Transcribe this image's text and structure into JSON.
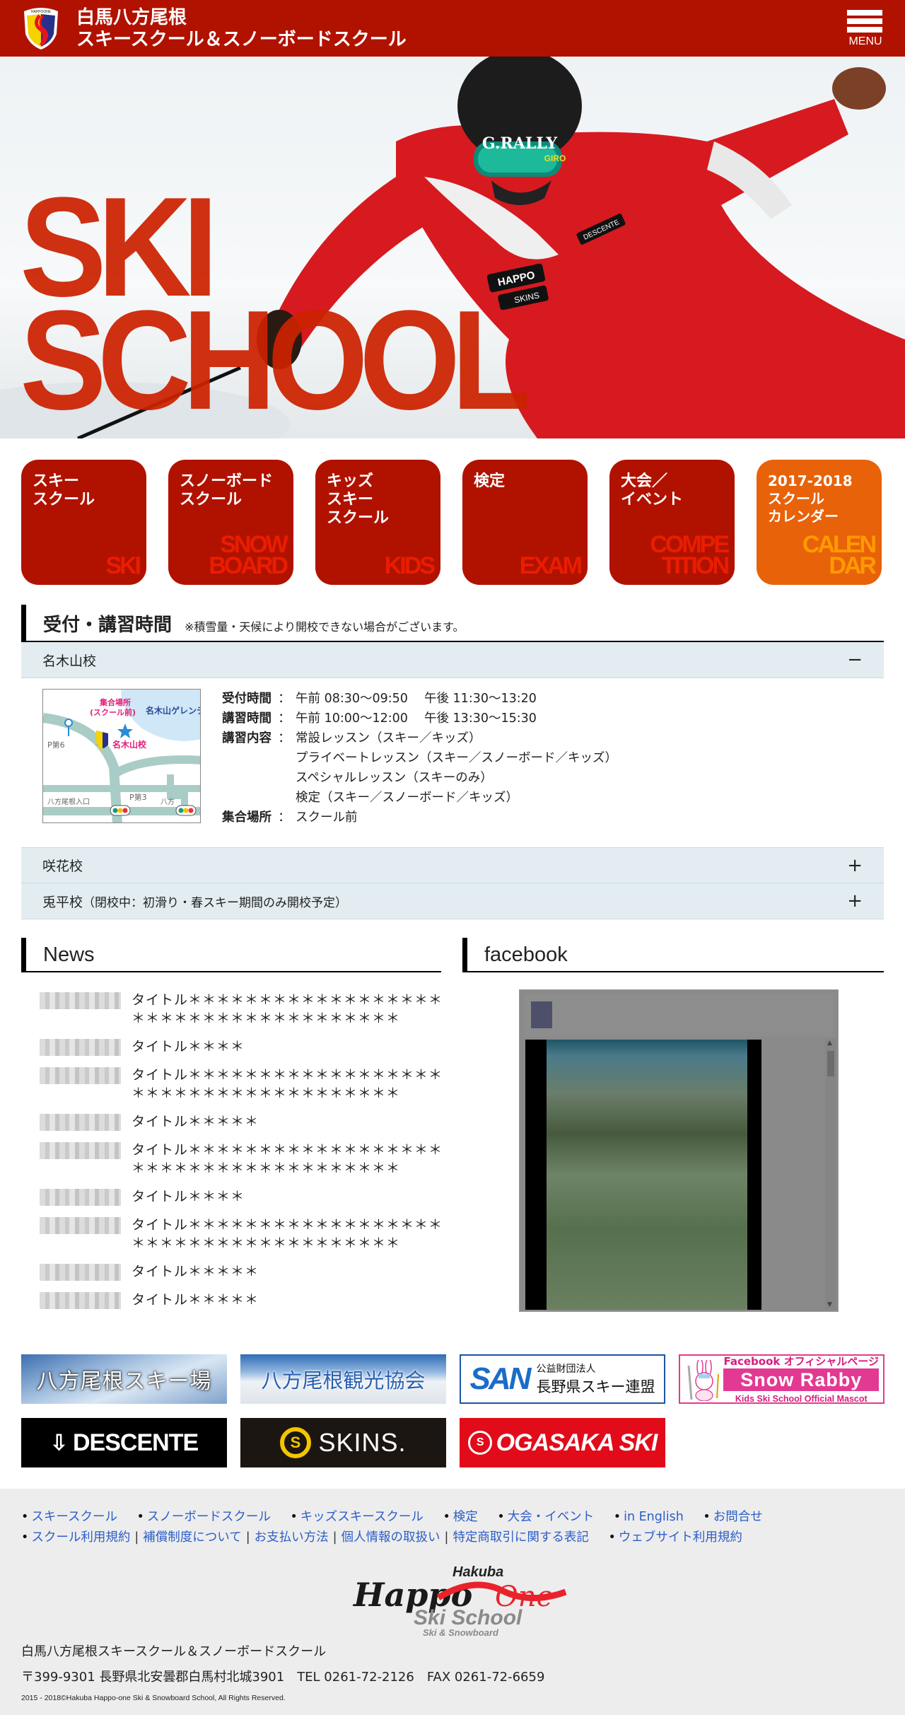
{
  "header": {
    "title_line1": "白馬八方尾根",
    "title_line2": "スキースクール＆スノーボードスクール",
    "logo_text": "HAPPOONE",
    "menu_label": "MENU"
  },
  "hero": {
    "line1": "SKI",
    "line2": "SCHOOL",
    "helmet_text": "G.RALLY",
    "helmet_brand": "GIRO",
    "badge_happo": "HAPPO",
    "badge_skins": "SKINS",
    "badge_descente": "DESCENTE"
  },
  "tiles": [
    {
      "jp": "スキー\nスクール",
      "en": "SKI",
      "color": "#b11200"
    },
    {
      "jp": "スノーボード\nスクール",
      "en": "SNOW\nBOARD",
      "color": "#b11200"
    },
    {
      "jp": "キッズ\nスキー\nスクール",
      "en": "KIDS",
      "color": "#b11200"
    },
    {
      "jp": "検定",
      "en": "EXAM",
      "color": "#b11200"
    },
    {
      "jp": "大会／\nイベント",
      "en": "COMPE\nTITION",
      "color": "#b11200"
    },
    {
      "jp": "2017-2018\nスクール\nカレンダー",
      "en": "CALEN\nDAR",
      "color": "#e8620a"
    }
  ],
  "hours": {
    "title": "受付・講習時間",
    "note": "※積雪量・天候により開校できない場合がございます。",
    "schools": [
      {
        "name": "名木山校",
        "sub": "",
        "expanded": true,
        "toggle": "−"
      },
      {
        "name": "咲花校",
        "sub": "",
        "expanded": false,
        "toggle": "+"
      },
      {
        "name": "兎平校",
        "sub": "（閉校中：初滑り・春スキー期間のみ開校予定）",
        "expanded": false,
        "toggle": "+"
      }
    ],
    "map": {
      "meeting_point": "集合場所\n（スクール前）",
      "slope": "名木山ゲレンデ",
      "school": "名木山校",
      "p6": "P第6",
      "p3": "P第3",
      "entrance": "八方尾根入口",
      "happo": "八方"
    },
    "details": [
      {
        "key": "受付時間",
        "colon": "：",
        "value": "午前 08:30〜09:50　 午後 11:30〜13:20"
      },
      {
        "key": "講習時間",
        "colon": "：",
        "value": "午前 10:00〜12:00　 午後 13:30〜15:30"
      },
      {
        "key": "講習内容",
        "colon": "：",
        "value": "常設レッスン（スキー／キッズ）"
      },
      {
        "key": "",
        "colon": "",
        "value": "プライベートレッスン（スキー／スノーボード／キッズ）"
      },
      {
        "key": "",
        "colon": "",
        "value": "スペシャルレッスン（スキーのみ）"
      },
      {
        "key": "",
        "colon": "",
        "value": "検定（スキー／スノーボード／キッズ）"
      },
      {
        "key": "集合場所",
        "colon": "：",
        "value": "スクール前"
      }
    ]
  },
  "news": {
    "title": "News",
    "items": [
      {
        "title": "タイトル＊＊＊＊＊＊＊＊＊＊＊＊＊＊＊＊＊＊＊＊＊＊＊＊＊＊＊＊＊＊＊＊＊＊＊＊＊"
      },
      {
        "title": "タイトル＊＊＊＊"
      },
      {
        "title": "タイトル＊＊＊＊＊＊＊＊＊＊＊＊＊＊＊＊＊＊＊＊＊＊＊＊＊＊＊＊＊＊＊＊＊＊＊＊＊"
      },
      {
        "title": "タイトル＊＊＊＊＊"
      },
      {
        "title": "タイトル＊＊＊＊＊＊＊＊＊＊＊＊＊＊＊＊＊＊＊＊＊＊＊＊＊＊＊＊＊＊＊＊＊＊＊＊＊"
      },
      {
        "title": "タイトル＊＊＊＊"
      },
      {
        "title": "タイトル＊＊＊＊＊＊＊＊＊＊＊＊＊＊＊＊＊＊＊＊＊＊＊＊＊＊＊＊＊＊＊＊＊＊＊＊＊"
      },
      {
        "title": "タイトル＊＊＊＊＊"
      },
      {
        "title": "タイトル＊＊＊＊＊"
      }
    ]
  },
  "facebook": {
    "title": "facebook"
  },
  "banners": {
    "ski_area": "八方尾根スキー場",
    "tourism": "八方尾根観光協会",
    "san_logo": "SAN",
    "san_line1": "公益財団法人",
    "san_line2": "長野県スキー連盟",
    "rabby_line1": "Facebook オフィシャルページ",
    "rabby_line2": "Snow Rabby",
    "rabby_line3": "Kids Ski School Official Mascot",
    "descente": "DESCENTE",
    "skins": "SKINS.",
    "ogasaka": "OGASAKA SKI"
  },
  "footer": {
    "links_row1": [
      "スキースクール",
      "スノーボードスクール",
      "キッズスキースクール",
      "検定",
      "大会・イベント",
      "in English",
      "お問合せ"
    ],
    "links_row2_group": [
      "スクール利用規約",
      "補償制度について",
      "お支払い方法",
      "個人情報の取扱い",
      "特定商取引に関する表記"
    ],
    "links_row2_last": "ウェブサイト利用規約",
    "logo_hakuba": "Hakuba",
    "logo_happo": "Happo",
    "logo_one": "One",
    "logo_skischool": "Ski School",
    "logo_sub": "Ski & Snowboard",
    "name": "白馬八方尾根スキースクール＆スノーボードスクール",
    "address": "〒399-9301 長野県北安曇郡白馬村北城3901　TEL 0261-72-2126　FAX 0261-72-6659",
    "copyright": "2015 - 2018©Hakuba Happo-one Ski & Snowboard School, All Rights Reserved."
  },
  "colors": {
    "brand_red": "#b11200",
    "calendar_orange": "#e8620a",
    "link_blue": "#2c5ec8",
    "accordion_bg": "#e3edf1"
  }
}
